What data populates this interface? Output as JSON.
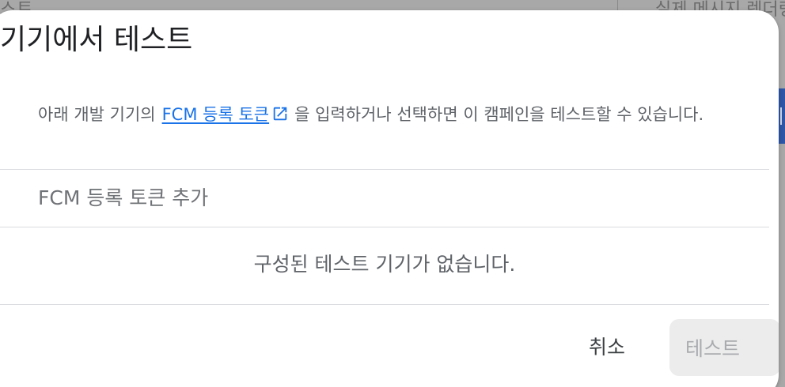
{
  "background": {
    "left_text": "스트",
    "right_text": "실제 메시지 렌더링"
  },
  "dialog": {
    "title": "기기에서 테스트",
    "description_prefix": "아래 개발 기기의",
    "link_label": "FCM 등록 토큰",
    "link_icon": "open-in-new-icon",
    "description_suffix": "을 입력하거나 선택하면 이 캠페인을 테스트할 수 있습니다.",
    "token_input": {
      "placeholder": "FCM 등록 토큰 추가",
      "value": ""
    },
    "empty_message": "구성된 테스트 기기가 없습니다.",
    "cancel_label": "취소",
    "test_label": "테스트",
    "test_enabled": false
  },
  "colors": {
    "link": "#1a73e8",
    "title": "#202124",
    "body_text": "#5f6368",
    "disabled_button_bg": "#ececec",
    "disabled_button_text": "#a9abae",
    "accent_panel": "#2e56a6"
  }
}
